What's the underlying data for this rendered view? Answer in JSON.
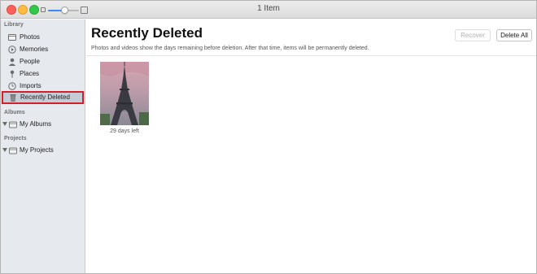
{
  "window": {
    "title": "1 Item"
  },
  "sidebar": {
    "library_header": "Library",
    "library_items": [
      {
        "label": "Photos",
        "icon": "photos-icon"
      },
      {
        "label": "Memories",
        "icon": "memories-icon"
      },
      {
        "label": "People",
        "icon": "people-icon"
      },
      {
        "label": "Places",
        "icon": "places-icon"
      },
      {
        "label": "Imports",
        "icon": "imports-icon"
      },
      {
        "label": "Recently Deleted",
        "icon": "trash-icon",
        "selected": true
      }
    ],
    "albums_header": "Albums",
    "albums_item": {
      "label": "My Albums",
      "icon": "folder-icon"
    },
    "projects_header": "Projects",
    "projects_item": {
      "label": "My Projects",
      "icon": "folder-icon"
    }
  },
  "main": {
    "title": "Recently Deleted",
    "recover_label": "Recover",
    "delete_all_label": "Delete All",
    "description": "Photos and videos show the days remaining before deletion. After that time, items will be permanently deleted.",
    "items": [
      {
        "caption": "29 days left",
        "subject": "eiffel-tower-photo"
      }
    ]
  },
  "toolbar": {
    "zoom_level": 0.55
  },
  "colors": {
    "selection_outline": "#d0202b",
    "sidebar_bg": "#e6e9ee",
    "selected_bg": "#c6ccd6"
  }
}
